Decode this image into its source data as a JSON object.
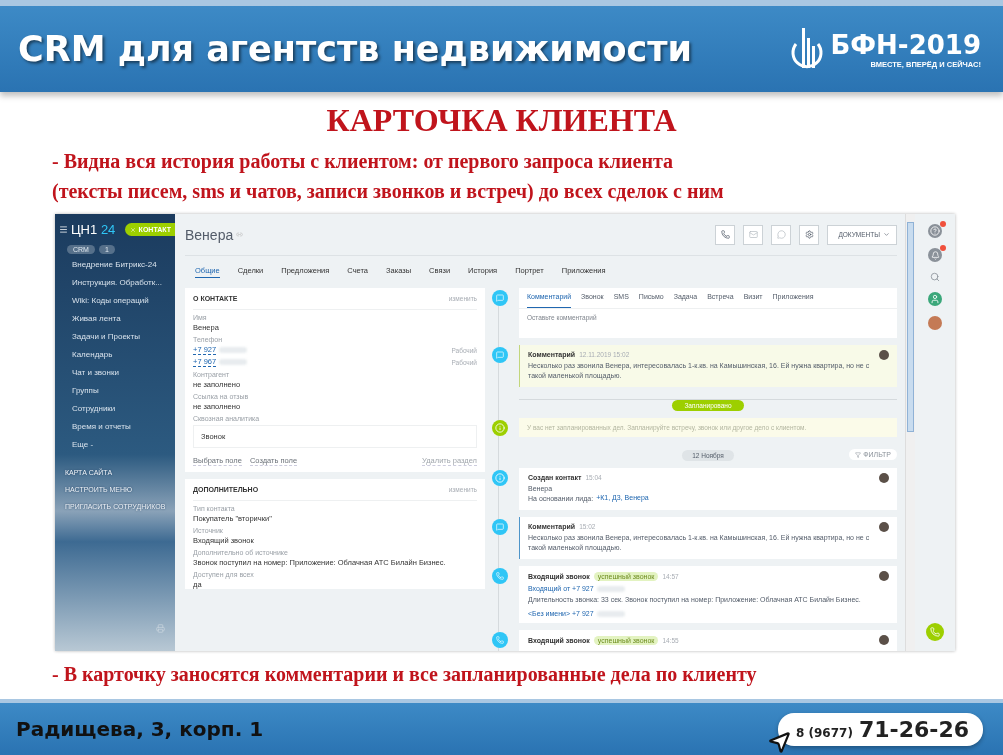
{
  "header": {
    "title": "CRM для агентств недвижимости",
    "logo_name": "БФН-2019",
    "logo_slogan": "ВМЕСТЕ, ВПЕРЁД И СЕЙЧАС!"
  },
  "heading": "КАРТОЧКА КЛИЕНТА",
  "intro_lines": [
    "- Видна вся история работы с клиентом: от первого запроса клиента",
    "(тексты писем, sms и чатов, записи звонков и встреч) до всех сделок с ним"
  ],
  "crm": {
    "sidebar": {
      "logo": "ЦН1",
      "logo_suffix": "24",
      "contact_button": "КОНТАКТ",
      "crm_badge": "CRM",
      "crm_count": "1",
      "items": [
        "Внедрение Битрикс-24",
        "Инструкция. Обработк...",
        "Wiki: Коды операций",
        "Живая лента",
        "Задачи и Проекты",
        "Календарь",
        "Чат и звонки",
        "Группы",
        "Сотрудники",
        "Время и отчеты",
        "Еще -"
      ],
      "footer_links": [
        "КАРТА САЙТА",
        "НАСТРОИТЬ МЕНЮ",
        "ПРИГЛАСИТЬ СОТРУДНИКОВ"
      ]
    },
    "title": "Венера",
    "documents_button": "ДОКУМЕНТЫ",
    "tabs": [
      {
        "label": "Общие",
        "selected": true
      },
      {
        "label": "Сделки",
        "selected": false
      },
      {
        "label": "Предложения",
        "selected": false
      },
      {
        "label": "Счета",
        "selected": false
      },
      {
        "label": "Заказы",
        "selected": false
      },
      {
        "label": "Связи",
        "selected": false
      },
      {
        "label": "История",
        "selected": false
      },
      {
        "label": "Портрет",
        "selected": false
      },
      {
        "label": "Приложения",
        "selected": false
      }
    ],
    "about": {
      "title": "О КОНТАКТЕ",
      "edit": "изменить",
      "fields": [
        {
          "kind": "text",
          "label": "Имя",
          "value": "Венера"
        },
        {
          "kind": "phones",
          "label": "Телефон",
          "phones": [
            {
              "number": "+7 927",
              "type": "Рабочий"
            },
            {
              "number": "+7 967",
              "type": "Рабочий"
            }
          ]
        },
        {
          "kind": "text",
          "label": "Контрагент",
          "value": "не заполнено"
        },
        {
          "kind": "text",
          "label": "Ссылка на отзыв",
          "value": "не заполнено"
        },
        {
          "kind": "box",
          "label": "Сквозная аналитика",
          "value": "Звонок"
        }
      ],
      "links": [
        "Выбрать поле",
        "Создать поле"
      ],
      "delete": "Удалить раздел"
    },
    "extra": {
      "title": "ДОПОЛНИТЕЛЬНО",
      "edit": "изменить",
      "fields": [
        {
          "kind": "text",
          "label": "Тип контакта",
          "value": "Покупатель \"вторички\""
        },
        {
          "kind": "text",
          "label": "Источник",
          "value": "Входящий звонок"
        },
        {
          "kind": "text",
          "label": "Дополнительно об источнике",
          "value": "Звонок поступил на номер: Приложение: Облачная АТС Билайн Бизнес."
        },
        {
          "kind": "text",
          "label": "Доступен для всех",
          "value": "да"
        }
      ]
    },
    "composer": {
      "tabs": [
        {
          "label": "Комментарий",
          "selected": true
        },
        {
          "label": "Звонок",
          "selected": false
        },
        {
          "label": "SMS",
          "selected": false
        },
        {
          "label": "Письмо",
          "selected": false
        },
        {
          "label": "Задача",
          "selected": false
        },
        {
          "label": "Встреча",
          "selected": false
        },
        {
          "label": "Визит",
          "selected": false
        },
        {
          "label": "Приложения",
          "selected": false
        }
      ],
      "placeholder": "Оставьте комментарий"
    },
    "timeline": [
      {
        "kind": "comment",
        "pinned": true,
        "title": "Комментарий",
        "time": "12.11.2019 15:02",
        "text": "Несколько раз звонила Венера, интересовалась 1-к.кв. на Камышинская, 16. Ей нужна квартира, но не с такой маленькой площадью."
      },
      {
        "kind": "badge",
        "text": "Запланировано"
      },
      {
        "kind": "notice",
        "text": "У вас нет запланированных дел. Запланируйте встречу, звонок или другое дело с клиентом."
      },
      {
        "kind": "date",
        "text": "12 Ноября",
        "filter": "ФИЛЬТР"
      },
      {
        "kind": "created",
        "title": "Создан контакт",
        "time": "15:04",
        "name": "Венера",
        "basis": "На основании лида:",
        "link": "+К1, Д3, Венера"
      },
      {
        "kind": "comment",
        "pinned": false,
        "title": "Комментарий",
        "time": "15:02",
        "text": "Несколько раз звонила Венера, интересовалась 1-к.кв. на Камышинская, 16. Ей нужна квартира, но не с такой маленькой площадью."
      },
      {
        "kind": "call",
        "title": "Входящий звонок",
        "tag": "успешный звонок",
        "time": "14:57",
        "from": "Входящий от +7 927",
        "text": "Длительность звонка: 33 сек. Звонок поступил на номер: Приложение: Облачная АТС Билайн Бизнес.",
        "caller": "<Без имени> +7 927"
      },
      {
        "kind": "call",
        "title": "Входящий звонок",
        "tag": "успешный звонок",
        "time": "14:55"
      }
    ]
  },
  "footer_note": "- В карточку заносятся комментарии и все запланированные дела по клиенту",
  "footer": {
    "address": "Радищева, 3, корп. 1",
    "phone_code": "8 (9677)",
    "phone": "71-26-26"
  }
}
